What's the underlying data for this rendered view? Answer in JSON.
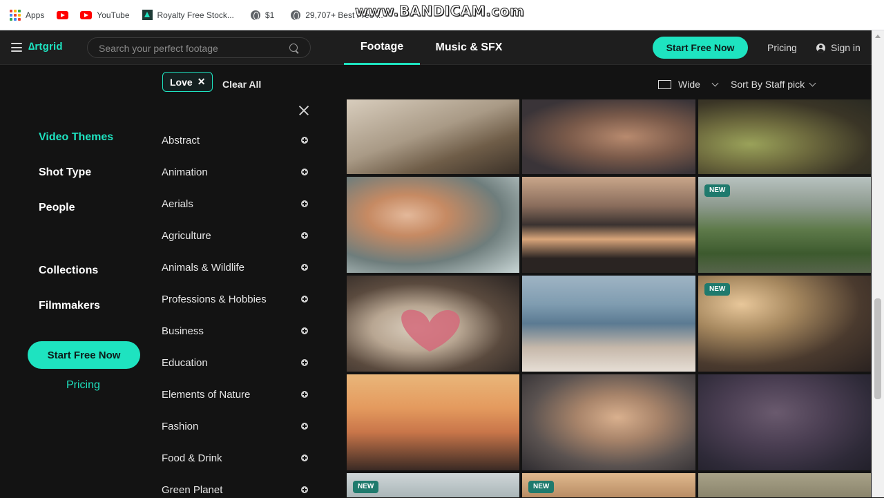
{
  "bookmarks": [
    {
      "label": "Apps",
      "icon": "apps-grid-icon"
    },
    {
      "label": "",
      "icon": "youtube-icon"
    },
    {
      "label": "YouTube",
      "icon": "youtube-icon"
    },
    {
      "label": "Royalty Free Stock...",
      "icon": "royalty-free-icon"
    },
    {
      "label": "$1",
      "icon": "globe-icon"
    },
    {
      "label": "29,707+ Best Free ...",
      "icon": "globe-icon"
    }
  ],
  "watermark": "www.BANDICAM.com",
  "header": {
    "logo": "∆rtgrid",
    "search_placeholder": "Search your perfect footage",
    "tabs": [
      "Footage",
      "Music & SFX"
    ],
    "cta_label": "Start Free Now",
    "pricing_label": "Pricing",
    "signin_label": "Sign in"
  },
  "filters": {
    "active_chip": "Love",
    "chip_close": "✕",
    "clear_all": "Clear All",
    "sidebar": [
      {
        "label": "Video Themes",
        "active": true
      },
      {
        "label": "Shot Type",
        "active": false
      },
      {
        "label": "People",
        "active": false
      },
      {
        "label": "Collections",
        "active": false
      },
      {
        "label": "Filmmakers",
        "active": false
      }
    ],
    "cta_label": "Start Free Now",
    "pricing_label": "Pricing",
    "themes": [
      "Abstract",
      "Animation",
      "Aerials",
      "Agriculture",
      "Animals & Wildlife",
      "Professions & Hobbies",
      "Business",
      "Education",
      "Elements of Nature",
      "Fashion",
      "Food & Drink",
      "Green Planet"
    ]
  },
  "results": {
    "layout_label": "Wide",
    "sort_label": "Sort By Staff pick",
    "new_badge": "NEW",
    "accent_color": "#1ee3c0"
  }
}
